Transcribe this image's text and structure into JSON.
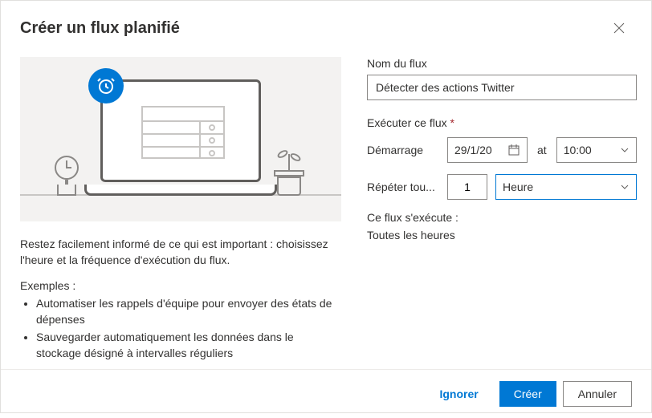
{
  "header": {
    "title": "Créer un flux planifié"
  },
  "left": {
    "description": "Restez facilement informé de ce qui est important : choisissez l'heure et la fréquence d'exécution du flux.",
    "examples_heading": "Exemples :",
    "examples": [
      "Automatiser les rappels d'équipe pour envoyer des états de dépenses",
      "Sauvegarder automatiquement les données dans le stockage désigné à intervalles réguliers"
    ]
  },
  "form": {
    "name_label": "Nom du flux",
    "name_value": "Détecter des actions Twitter",
    "run_section_label": "Exécuter ce flux",
    "start_label": "Démarrage",
    "start_date": "29/1/20",
    "at_label": "at",
    "start_time": "10:00",
    "repeat_label": "Répéter tou...",
    "repeat_count": "1",
    "repeat_unit": "Heure",
    "summary_label": "Ce flux s'exécute :",
    "summary_value": "Toutes les heures"
  },
  "footer": {
    "skip": "Ignorer",
    "create": "Créer",
    "cancel": "Annuler"
  }
}
